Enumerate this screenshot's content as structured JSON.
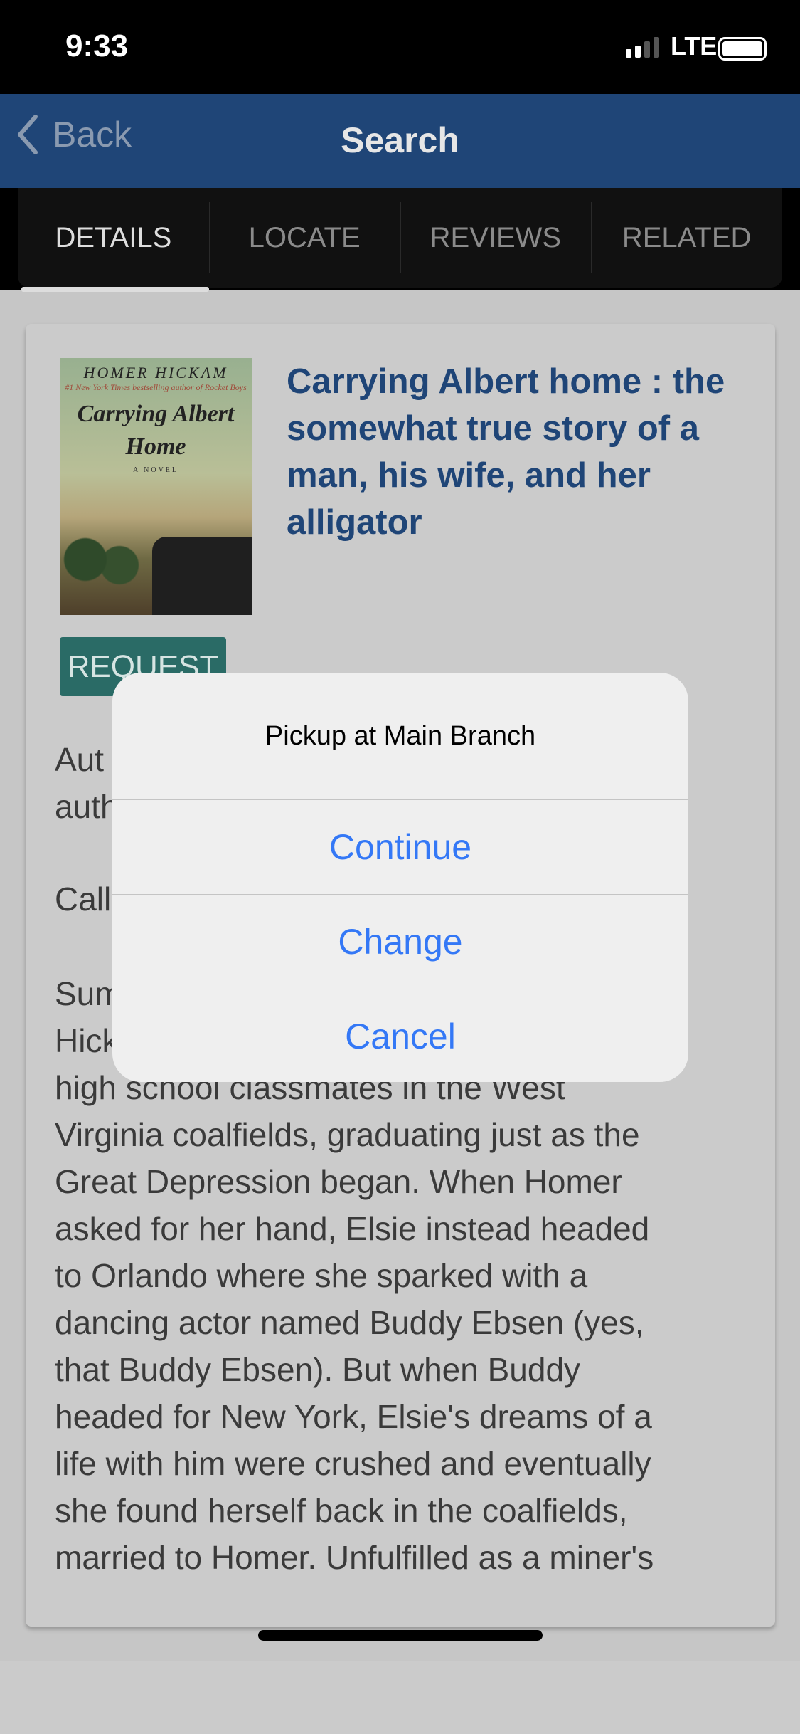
{
  "status": {
    "time": "9:33",
    "network": "LTE",
    "signal_bars": 2,
    "battery_level": 0.9
  },
  "nav": {
    "back_label": "Back",
    "title": "Search"
  },
  "tabs": [
    {
      "label": "DETAILS",
      "active": true
    },
    {
      "label": "LOCATE"
    },
    {
      "label": "REVIEWS"
    },
    {
      "label": "RELATED"
    }
  ],
  "book": {
    "cover": {
      "author": "HOMER HICKAM",
      "tagline": "#1 New York Times bestselling author of Rocket Boys",
      "title": "Carrying Albert Home",
      "subtitle": "A NOVEL"
    },
    "title": "Carrying Albert home : the somewhat true story of a man, his wife, and her alligator",
    "request_label": "REQUEST",
    "visible_lines": [
      "Aut",
      "auth",
      "Call",
      "Sum",
      "Hick",
      "high school classmates in the West",
      "Virginia coalfields, graduating just as the",
      "Great Depression began. When Homer",
      "asked for her hand, Elsie instead headed",
      "to Orlando where she sparked with a",
      "dancing actor named Buddy Ebsen (yes,",
      "that Buddy Ebsen). But when Buddy",
      "headed for New York, Elsie's dreams of a",
      "life with him were crushed and eventually",
      "she found herself back in the coalfields,",
      "married to Homer. Unfulfilled as a miner's"
    ]
  },
  "dialog": {
    "title": "Pickup at Main Branch",
    "buttons": [
      "Continue",
      "Change",
      "Cancel"
    ]
  },
  "colors": {
    "nav": "#1f4577",
    "accent": "#2a6b66",
    "link": "#3478f6"
  }
}
